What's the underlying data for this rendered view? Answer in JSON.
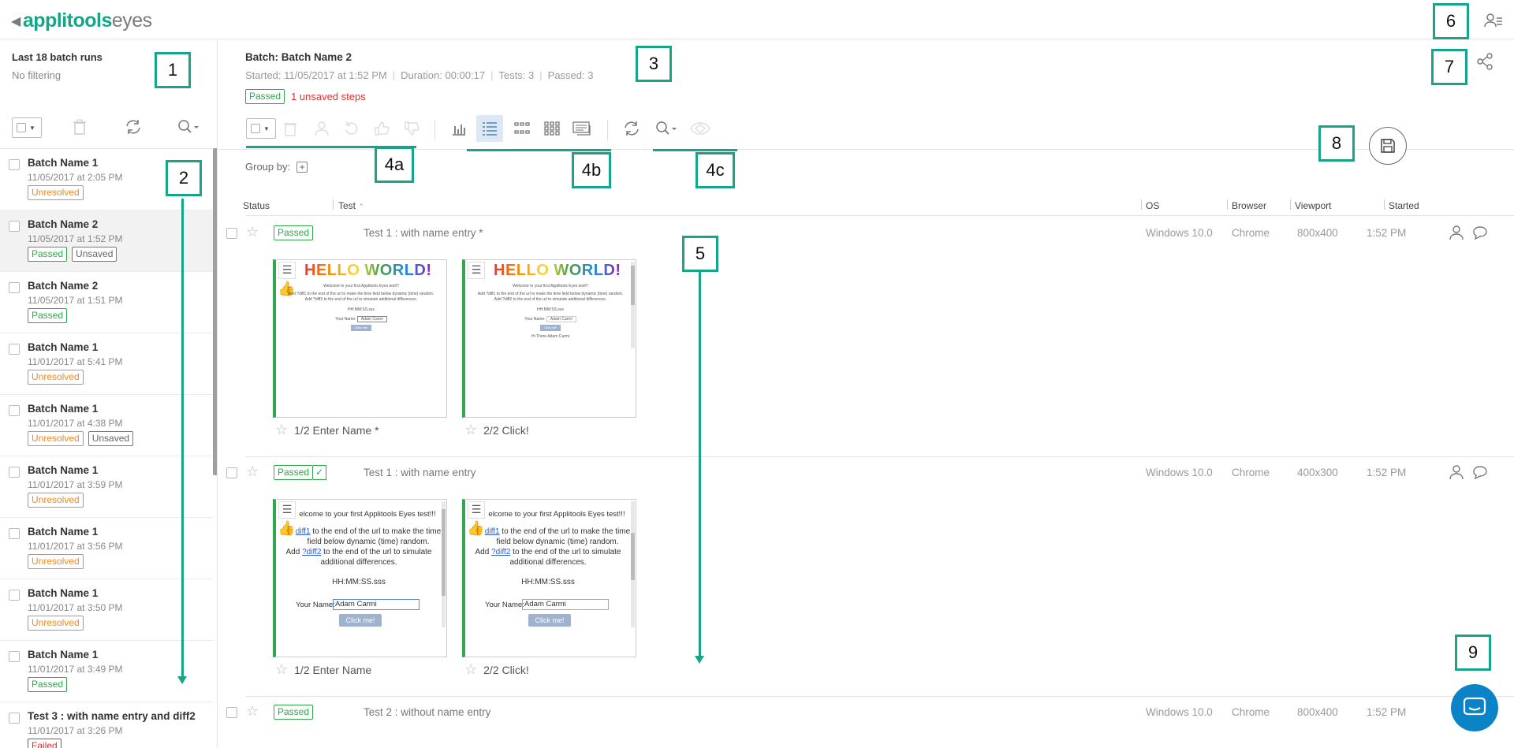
{
  "app": {
    "brand": "applitools",
    "product": "eyes"
  },
  "sidebar": {
    "title": "Last 18 batch runs",
    "subtitle": "No filtering",
    "batches": [
      {
        "name": "Batch Name 1",
        "date": "11/05/2017 at 2:05 PM",
        "badges": [
          "Unresolved"
        ]
      },
      {
        "name": "Batch Name 2",
        "date": "11/05/2017 at 1:52 PM",
        "badges": [
          "Passed",
          "Unsaved"
        ]
      },
      {
        "name": "Batch Name 2",
        "date": "11/05/2017 at 1:51 PM",
        "badges": [
          "Passed"
        ]
      },
      {
        "name": "Batch Name 1",
        "date": "11/01/2017 at 5:41 PM",
        "badges": [
          "Unresolved"
        ]
      },
      {
        "name": "Batch Name 1",
        "date": "11/01/2017 at 4:38 PM",
        "badges": [
          "Unresolved",
          "Unsaved"
        ]
      },
      {
        "name": "Batch Name 1",
        "date": "11/01/2017 at 3:59 PM",
        "badges": [
          "Unresolved"
        ]
      },
      {
        "name": "Batch Name 1",
        "date": "11/01/2017 at 3:56 PM",
        "badges": [
          "Unresolved"
        ]
      },
      {
        "name": "Batch Name 1",
        "date": "11/01/2017 at 3:50 PM",
        "badges": [
          "Unresolved"
        ]
      },
      {
        "name": "Batch Name 1",
        "date": "11/01/2017 at 3:49 PM",
        "badges": [
          "Passed"
        ]
      },
      {
        "name": "Test 3 : with name entry and diff2",
        "date": "11/01/2017 at 3:26 PM",
        "badges": [
          "Failed"
        ]
      }
    ]
  },
  "batch": {
    "title": "Batch: Batch Name 2",
    "started": "Started: 11/05/2017 at 1:52 PM",
    "duration": "Duration: 00:00:17",
    "tests": "Tests: 3",
    "passed": "Passed: 3",
    "status": "Passed",
    "unsaved": "1 unsaved steps"
  },
  "groupby": {
    "label": "Group by:"
  },
  "columns": {
    "status": "Status",
    "test": "Test",
    "os": "OS",
    "browser": "Browser",
    "viewport": "Viewport",
    "started": "Started"
  },
  "tests": [
    {
      "status": "Passed",
      "name": "Test 1 : with name entry *",
      "os": "Windows 10.0",
      "browser": "Chrome",
      "viewport": "800x400",
      "time": "1:52 PM",
      "steps": [
        "1/2 Enter Name *",
        "2/2 Click!"
      ]
    },
    {
      "status": "Passed",
      "name": "Test 1 : with name entry",
      "os": "Windows 10.0",
      "browser": "Chrome",
      "viewport": "400x300",
      "time": "1:52 PM",
      "steps": [
        "1/2 Enter Name",
        "2/2 Click!"
      ]
    },
    {
      "status": "Passed",
      "name": "Test 2 : without name entry",
      "os": "Windows 10.0",
      "browser": "Chrome",
      "viewport": "800x400",
      "time": "1:52 PM"
    }
  ],
  "thumbs": {
    "hello": "HELLO WORLD!",
    "welcome_small": "Welcome to your first Applitools Eyes test!!!",
    "diff1_small": "Add ?diff1 to the end of the url to make the time field below dynamic (time) random.",
    "diff2_small": "Add ?diff2 to the end of the url to simulate additional differences.",
    "time_small": "HH:MM:SS.sss",
    "your_name": "Your Name:",
    "name_value": "Adam Carmi",
    "click_me": "Click me!",
    "hi_there": "Hi There Adam Carmi",
    "welcome_big": "elcome to your first Applitools Eyes test!!!",
    "diff1_link": "diff1",
    "diff1_big": " to the end of the url to make the time field below dynamic (time) random.",
    "diff2_prefix": "Add ",
    "diff2_link": "?diff2",
    "diff2_big": " to the end of the url to simulate additional differences.",
    "time_big": "HH:MM:SS.sss",
    "your_name_big": "Your Name:"
  },
  "annotations": [
    "1",
    "2",
    "3",
    "4a",
    "4b",
    "4c",
    "5",
    "6",
    "7",
    "8",
    "9"
  ],
  "colors": {
    "accent": "#17a589",
    "passed": "#2ea84a",
    "unresolved": "#f08a24",
    "failed": "#e03030"
  }
}
